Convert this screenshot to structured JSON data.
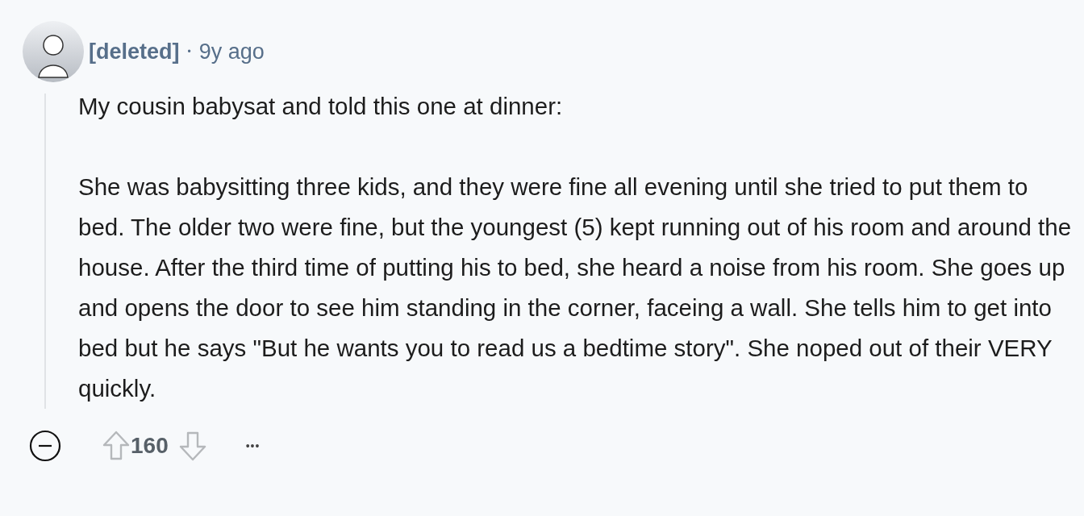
{
  "comment": {
    "author": "[deleted]",
    "separator": "•",
    "time": "9y ago",
    "paragraphs": [
      "My cousin babysat and told this one at dinner:",
      "She was babysitting three kids, and they were fine all evening until she tried to put them to bed. The older two were fine, but the youngest (5) kept running out of his room and around the house. After the third time of putting his to bed, she heard a noise from his room. She goes up and opens the door to see him standing in the corner, faceing a wall. She tells him to get into bed but he says \"But he wants you to read us a bedtime story\". She noped out of their VERY quickly."
    ],
    "score": "160",
    "more": "•••"
  }
}
